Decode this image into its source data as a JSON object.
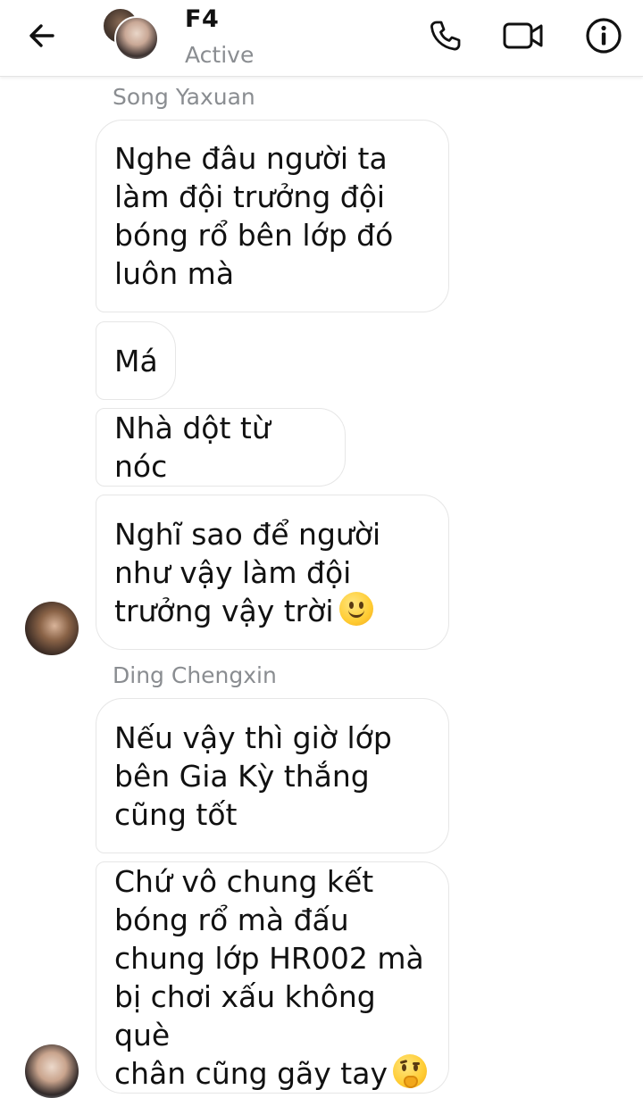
{
  "header": {
    "title": "F4",
    "status": "Active",
    "back_icon": "arrow-left-icon",
    "call_icon": "phone-icon",
    "video_icon": "video-camera-icon",
    "info_icon": "info-icon"
  },
  "messages": {
    "sender_1": "Song Yaxuan",
    "msg_1": "Nghe đâu người ta\nlàm đội trưởng đội\nbóng rổ bên lớp đó\nluôn mà",
    "msg_2": "Má",
    "msg_3": "Nhà dột từ nóc",
    "msg_4": "Nghĩ sao để người\nnhư vậy làm đội\ntrưởng vậy trời",
    "msg_4_emoji": "slightly-smiling-face",
    "sender_2": "Ding Chengxin",
    "msg_5": "Nếu vậy thì giờ lớp\nbên Gia Kỳ thắng\ncũng tốt",
    "msg_6": "Chứ vô chung kết\nbóng rổ mà đấu\nchung lớp HR002 mà\nbị chơi xấu không què\nchân cũng gãy tay",
    "msg_6_emoji": "thinking-face"
  },
  "colors": {
    "bubble_border": "#e6e6e6",
    "meta_text": "#8a8d91",
    "text": "#111111"
  }
}
